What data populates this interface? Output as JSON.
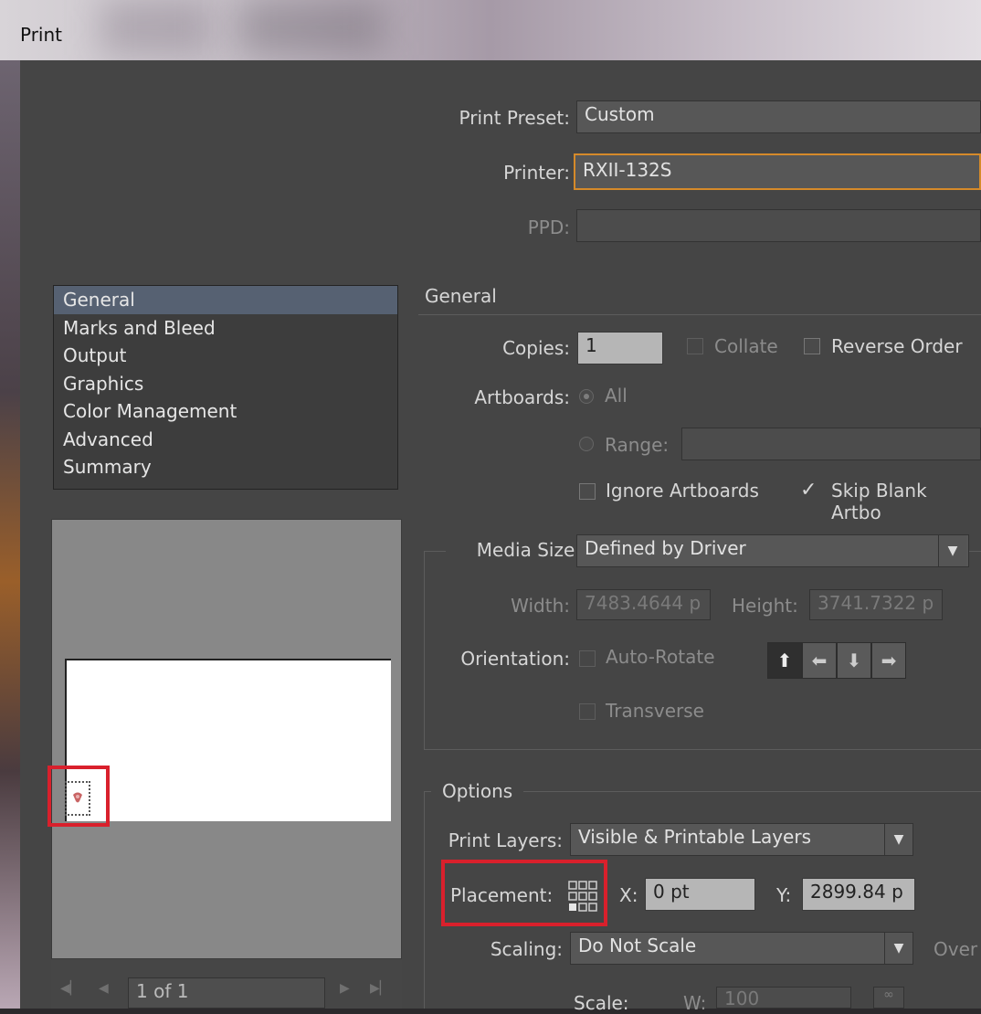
{
  "window": {
    "title": "Print"
  },
  "top": {
    "print_preset_label": "Print Preset:",
    "print_preset_value": "Custom",
    "printer_label": "Printer:",
    "printer_value": "RXII-132S",
    "ppd_label": "PPD:",
    "ppd_value": ""
  },
  "categories": {
    "items": [
      "General",
      "Marks and Bleed",
      "Output",
      "Graphics",
      "Color Management",
      "Advanced",
      "Summary"
    ],
    "selected": "General"
  },
  "general": {
    "heading": "General",
    "copies_label": "Copies:",
    "copies_value": "1",
    "collate_label": "Collate",
    "reverse_order_label": "Reverse Order",
    "artboards_label": "Artboards:",
    "all_label": "All",
    "range_label": "Range:",
    "ignore_artboards_label": "Ignore Artboards",
    "skip_blank_label": "Skip Blank Artbo"
  },
  "media": {
    "media_size_label": "Media Size:",
    "media_size_value": "Defined by Driver",
    "width_label": "Width:",
    "width_value": "7483.4644 p",
    "height_label": "Height:",
    "height_value": "3741.7322 p",
    "orientation_label": "Orientation:",
    "auto_rotate_label": "Auto-Rotate",
    "transverse_label": "Transverse"
  },
  "options": {
    "heading": "Options",
    "print_layers_label": "Print Layers:",
    "print_layers_value": "Visible & Printable Layers",
    "placement_label": "Placement:",
    "x_label": "X:",
    "x_value": "0 pt",
    "y_label": "Y:",
    "y_value": "2899.84 p",
    "scaling_label": "Scaling:",
    "scaling_value": "Do Not Scale",
    "overlap_label": "Over",
    "scale_label": "Scale:",
    "w_label": "W:",
    "w_value": "100"
  },
  "preview": {
    "page_value": "1 of 1"
  },
  "icons": [
    "first-page-icon",
    "prev-page-icon",
    "next-page-icon",
    "last-page-icon",
    "portrait-icon",
    "landscape-icon",
    "portrait-flipped-icon",
    "landscape-flipped-icon",
    "placement-grid-icon",
    "dropdown-arrow-icon",
    "constrain-icon"
  ],
  "colors": {
    "highlight": "#d9202c",
    "focus": "#d58a2a",
    "selection": "#566172"
  }
}
